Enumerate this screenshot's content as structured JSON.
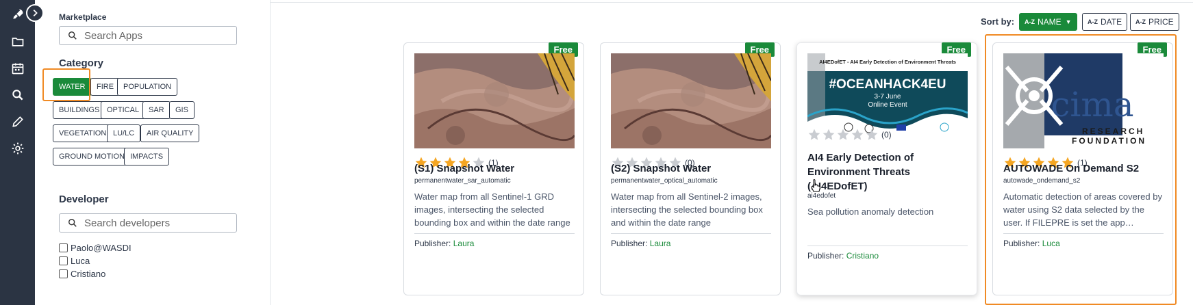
{
  "sidebar_rail": {
    "items": [
      {
        "icon": "rocket-icon"
      },
      {
        "icon": "folder-icon"
      },
      {
        "icon": "calendar-icon"
      },
      {
        "icon": "search-icon"
      },
      {
        "icon": "pencil-icon"
      },
      {
        "icon": "gear-icon"
      }
    ],
    "toggle_icon": "chevron-right-icon"
  },
  "filters": {
    "marketplace_label": "Marketplace",
    "search_apps_placeholder": "Search Apps",
    "category_title": "Category",
    "categories": [
      "WATER",
      "FIRE",
      "POPULATION",
      "BUILDINGS",
      "OPTICAL",
      "SAR",
      "GIS",
      "VEGETATION",
      "LU/LC",
      "AIR QUALITY",
      "GROUND MOTION",
      "IMPACTS"
    ],
    "active_category": "WATER",
    "developer_title": "Developer",
    "search_developers_placeholder": "Search developers",
    "developers": [
      "Paolo@WASDI",
      "Luca",
      "Cristiano"
    ]
  },
  "sort": {
    "label": "Sort by:",
    "name": "NAME",
    "date": "DATE",
    "price": "PRICE",
    "az": "A-Z",
    "active": "NAME"
  },
  "cards": [
    {
      "badge": "Free",
      "image": "satellite-terrain-image",
      "rating": 4,
      "rating_count": "(1)",
      "title": "(S1) Snapshot Water",
      "id": "permanentwater_sar_automatic",
      "description": "Water map from all Sentinel-1 GRD images, intersecting the selected bounding box and within the date range",
      "publisher_label": "Publisher:",
      "publisher": "Laura"
    },
    {
      "badge": "Free",
      "image": "satellite-terrain-image",
      "rating": 0,
      "rating_count": "(0)",
      "title": "(S2) Snapshot Water",
      "id": "permanentwater_optical_automatic",
      "description": "Water map from all Sentinel-2 images, intersecting the selected bounding box and within the date range",
      "publisher_label": "Publisher:",
      "publisher": "Laura"
    },
    {
      "badge": "Free",
      "image": "oceanhack-banner-image",
      "banner_header": "AI4EDofET - AI4 Early Detection of Environment Threats",
      "banner_title": "#OCEANHACK4EU",
      "banner_date": "3-7 June",
      "banner_event": "Online Event",
      "rating": 0,
      "rating_count": "(0)",
      "title": "AI4 Early Detection of Environment Threats (AI4EDofET)",
      "id": "ai4edofet",
      "description": "Sea pollution anomaly detection",
      "publisher_label": "Publisher:",
      "publisher": "Cristiano"
    },
    {
      "badge": "Free",
      "image": "cima-foundation-logo",
      "logo_text": "cima",
      "logo_line1": "RESEARCH",
      "logo_line2": "FOUNDATION",
      "rating": 5,
      "rating_count": "(1)",
      "title": "AUTOWADE On Demand S2",
      "id": "autowade_ondemand_s2",
      "description": "Automatic detection of areas covered by water using S2 data selected by the user. If FILEPRE is set the app compares the results",
      "publisher_label": "Publisher:",
      "publisher": "Luca"
    }
  ],
  "colors": {
    "accent": "#1a8a3a",
    "rail": "#2b3443",
    "highlight": "#f08a24",
    "star_filled": "#f5a623",
    "star_empty": "#c9ccd1"
  }
}
